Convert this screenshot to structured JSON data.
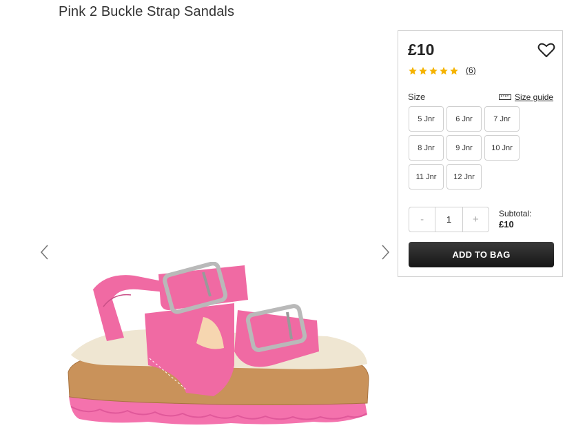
{
  "product": {
    "title": "Pink 2 Buckle Strap Sandals",
    "image_alt": "sandal-image"
  },
  "gallery": {
    "prev_icon": "chevron-left-icon",
    "next_icon": "chevron-right-icon"
  },
  "panel": {
    "price": "£10",
    "wishlist_icon": "heart-icon",
    "rating": 5,
    "reviews": "(6)",
    "size_label": "Size",
    "size_guide_label": "Size guide",
    "size_guide_icon": "ruler-icon",
    "sizes": [
      "5 Jnr",
      "6 Jnr",
      "7 Jnr",
      "8 Jnr",
      "9 Jnr",
      "10 Jnr",
      "11 Jnr",
      "12 Jnr"
    ],
    "quantity": {
      "minus": "-",
      "value": "1",
      "plus": "+"
    },
    "subtotal_label": "Subtotal:",
    "subtotal_value": "£10",
    "add_to_bag": "ADD TO BAG"
  },
  "colors": {
    "star": "#f5b301",
    "button": "#222222",
    "shoe_pink": "#f06aa3"
  }
}
